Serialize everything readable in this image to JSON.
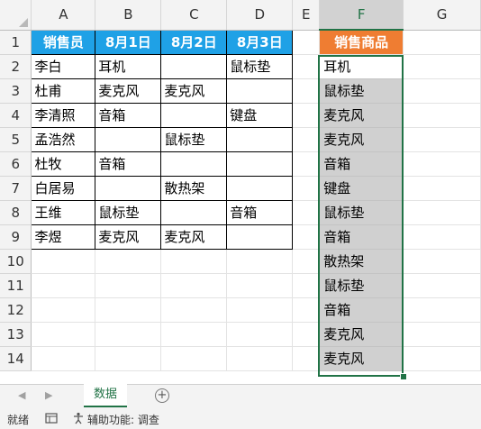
{
  "columns": [
    "A",
    "B",
    "C",
    "D",
    "E",
    "F",
    "G"
  ],
  "selected_column": "F",
  "rows": [
    "1",
    "2",
    "3",
    "4",
    "5",
    "6",
    "7",
    "8",
    "9",
    "10",
    "11",
    "12",
    "13",
    "14"
  ],
  "header": {
    "seller": "销售员",
    "dates": [
      "8月1日",
      "8月2日",
      "8月3日"
    ],
    "products": "销售商品"
  },
  "sales": [
    {
      "name": "李白",
      "d1": "耳机",
      "d2": "",
      "d3": "鼠标垫"
    },
    {
      "name": "杜甫",
      "d1": "麦克风",
      "d2": "麦克风",
      "d3": ""
    },
    {
      "name": "李清照",
      "d1": "音箱",
      "d2": "",
      "d3": "键盘"
    },
    {
      "name": "孟浩然",
      "d1": "",
      "d2": "鼠标垫",
      "d3": ""
    },
    {
      "name": "杜牧",
      "d1": "音箱",
      "d2": "",
      "d3": ""
    },
    {
      "name": "白居易",
      "d1": "",
      "d2": "散热架",
      "d3": ""
    },
    {
      "name": "王维",
      "d1": "鼠标垫",
      "d2": "",
      "d3": "音箱"
    },
    {
      "name": "李煜",
      "d1": "麦克风",
      "d2": "麦克风",
      "d3": ""
    }
  ],
  "product_list": [
    "耳机",
    "鼠标垫",
    "麦克风",
    "麦克风",
    "音箱",
    "键盘",
    "鼠标垫",
    "音箱",
    "散热架",
    "鼠标垫",
    "音箱",
    "麦克风",
    "麦克风"
  ],
  "sheet_tab": "数据",
  "status": {
    "ready": "就绪",
    "accessibility": "辅助功能: 调查"
  },
  "colors": {
    "header_blue": "#1fa1e6",
    "header_orange": "#ef7d32",
    "selection_green": "#217346",
    "selection_fill": "#d0d0d0"
  }
}
